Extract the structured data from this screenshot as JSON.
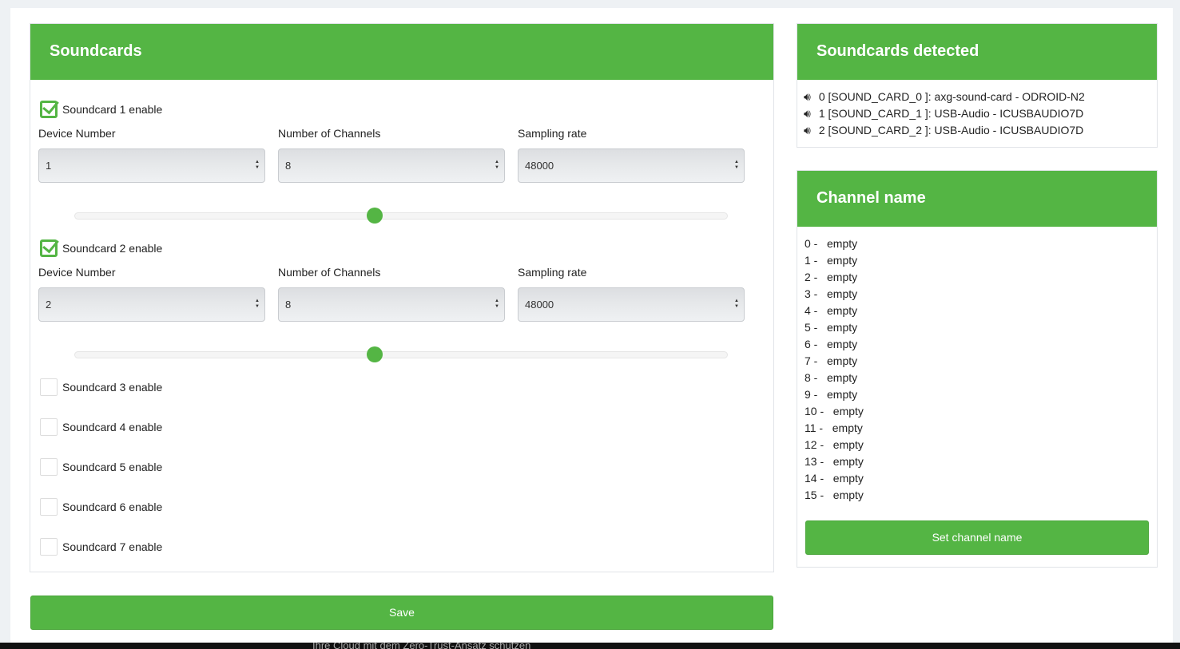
{
  "soundcards": {
    "title": "Soundcards",
    "device_label": "Device Number",
    "channels_label": "Number of Channels",
    "rate_label": "Sampling rate",
    "cards": [
      {
        "label": "Soundcard 1 enable",
        "enabled": true,
        "device": "1",
        "channels": "8",
        "rate": "48000",
        "slider_percent": 46
      },
      {
        "label": "Soundcard 2 enable",
        "enabled": true,
        "device": "2",
        "channels": "8",
        "rate": "48000",
        "slider_percent": 46
      },
      {
        "label": "Soundcard 3 enable",
        "enabled": false
      },
      {
        "label": "Soundcard 4 enable",
        "enabled": false
      },
      {
        "label": "Soundcard 5 enable",
        "enabled": false
      },
      {
        "label": "Soundcard 6 enable",
        "enabled": false
      },
      {
        "label": "Soundcard 7 enable",
        "enabled": false
      }
    ],
    "save_label": "Save"
  },
  "detected": {
    "title": "Soundcards detected",
    "items": [
      "0 [SOUND_CARD_0 ]: axg-sound-card - ODROID-N2",
      "1 [SOUND_CARD_1 ]: USB-Audio - ICUSBAUDIO7D",
      "2 [SOUND_CARD_2 ]: USB-Audio - ICUSBAUDIO7D"
    ]
  },
  "channel_names": {
    "title": "Channel name",
    "items": [
      "0 -   empty",
      "1 -   empty",
      "2 -   empty",
      "3 -   empty",
      "4 -   empty",
      "5 -   empty",
      "6 -   empty",
      "7 -   empty",
      "8 -   empty",
      "9 -   empty",
      "10 -   empty",
      "11 -   empty",
      "12 -   empty",
      "13 -   empty",
      "14 -   empty",
      "15 -   empty"
    ],
    "button_label": "Set channel name"
  },
  "taskbar_text": "Ihre Cloud mit dem Zero-Trust-Ansatz schützen",
  "colors": {
    "accent": "#54b544"
  }
}
